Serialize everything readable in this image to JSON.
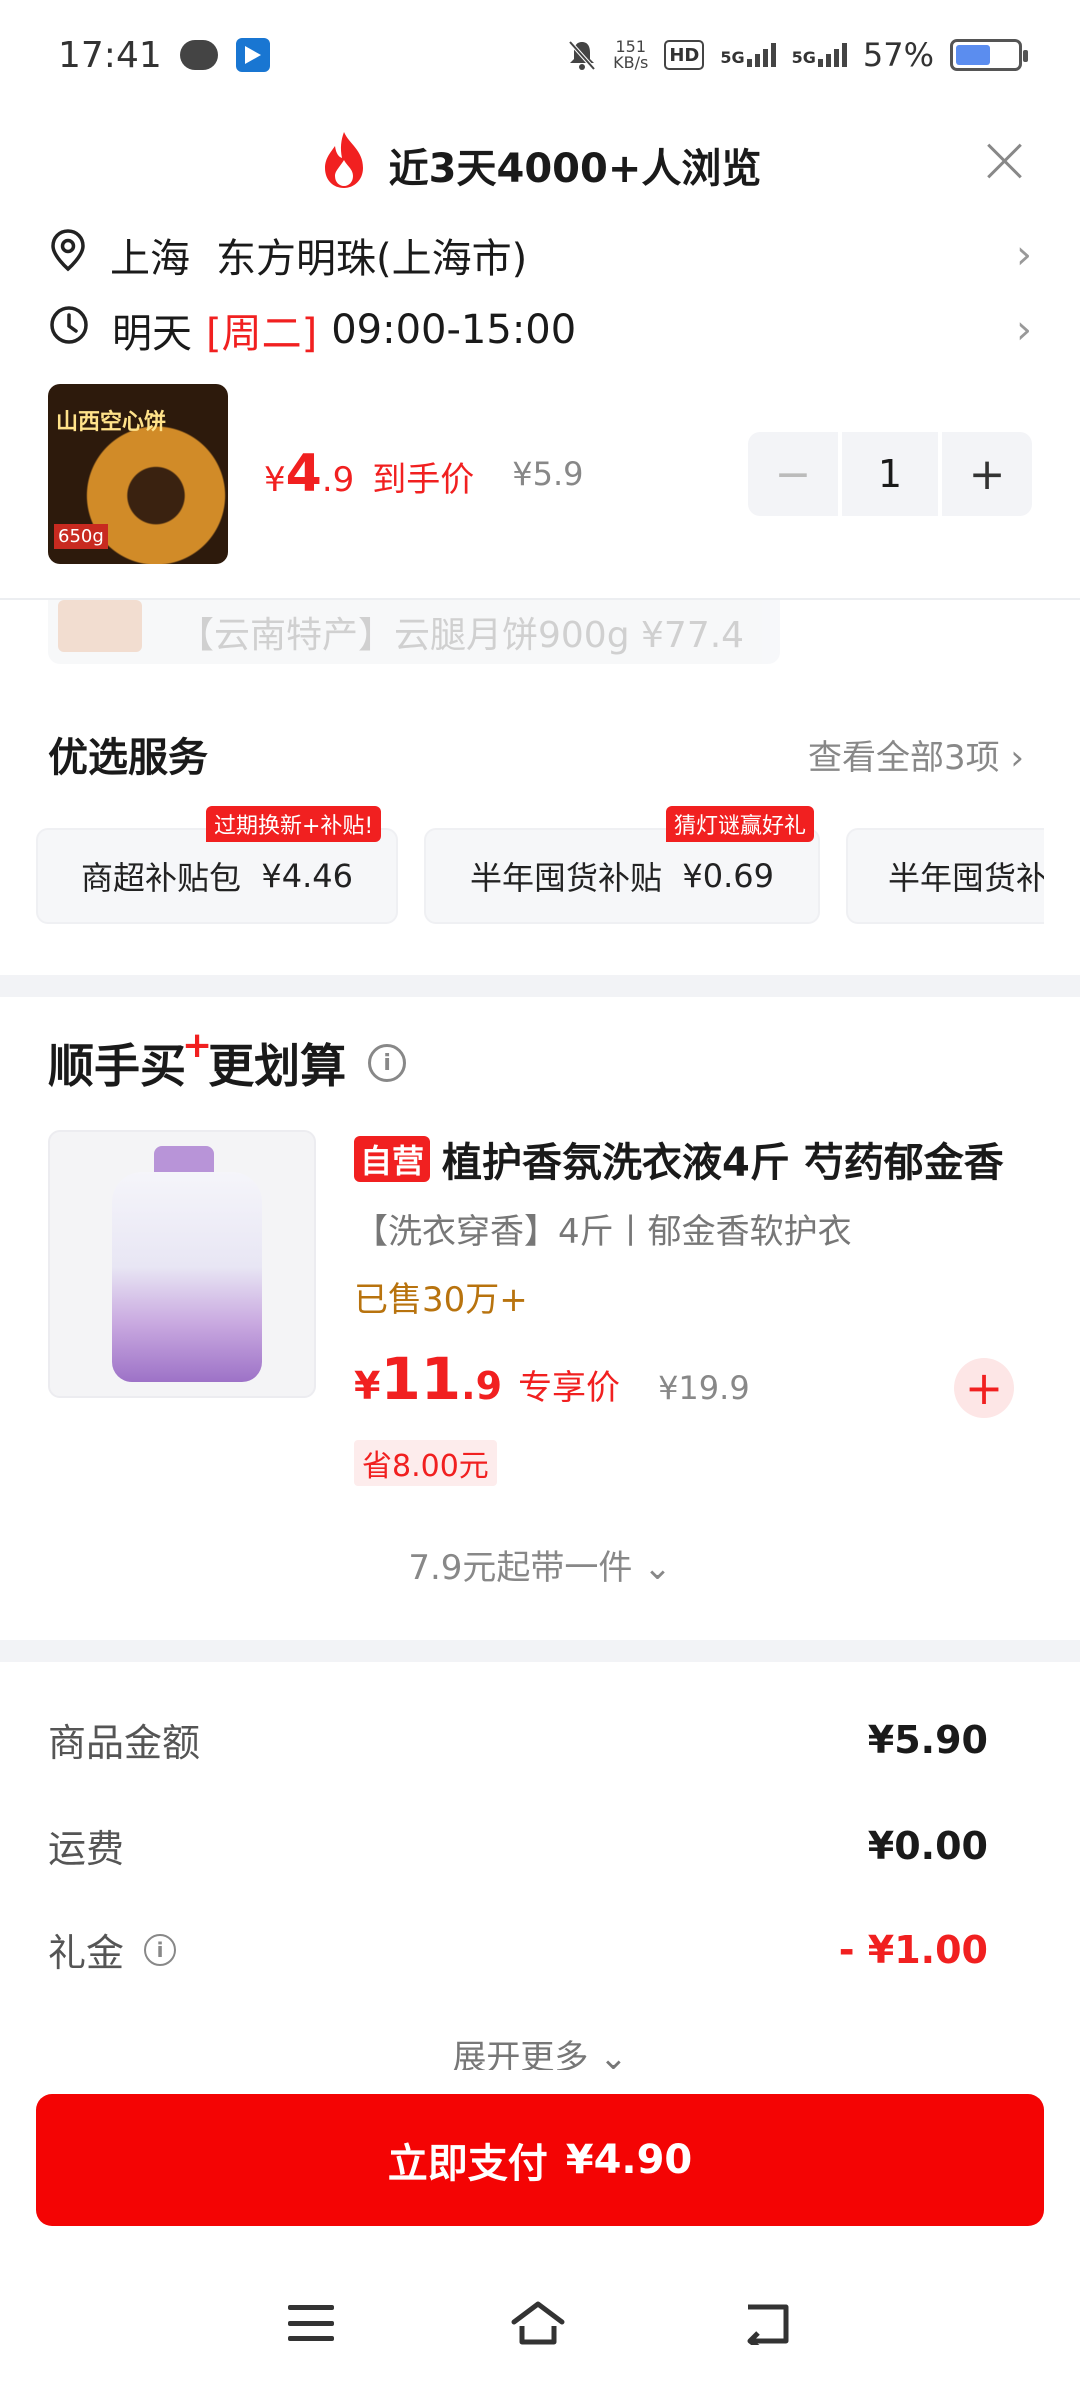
{
  "status_bar": {
    "time": "17:41",
    "net_speed_value": "151",
    "net_speed_unit": "KB/s",
    "hd_label": "HD",
    "signal1": "5G",
    "signal2": "5G",
    "battery": "57%",
    "battery_level": 0.57
  },
  "header": {
    "browse_text": "近3天4000+人浏览",
    "address": {
      "city": "上海",
      "place": "东方明珠(上海市)"
    },
    "delivery": {
      "day": "明天",
      "weekday": "[周二]",
      "hours": "09:00-15:00"
    }
  },
  "product": {
    "thumb_text": "山西空心饼",
    "thumb_weight": "650g",
    "price_currency": "¥",
    "price_int": "4",
    "price_dec": ".9",
    "price_label": "到手价",
    "original_price": "¥5.9",
    "quantity": "1",
    "minus": "−",
    "plus": "+"
  },
  "ghost_item": {
    "text": "【云南特产】云腿月饼900g  ¥77.4"
  },
  "services": {
    "title": "优选服务",
    "more": "查看全部3项 ›",
    "items": [
      {
        "name": "商超补贴包",
        "price": "¥4.46",
        "tag": "过期换新+补贴!"
      },
      {
        "name": "半年囤货补贴",
        "price": "¥0.69",
        "tag": "猜灯谜赢好礼"
      },
      {
        "name": "半年囤货补",
        "price": ""
      }
    ]
  },
  "buy_together": {
    "title_a": "顺手买",
    "title_plus": "+",
    "title_b": "更划算",
    "info": "i",
    "tag": "自营",
    "name": "植护香氛洗衣液4斤 芍药郁金香",
    "subtitle": "【洗衣穿香】4斤丨郁金香软护衣",
    "sold": "已售30万+",
    "price_currency": "¥",
    "price_int": "11",
    "price_dec": ".9",
    "price_label": "专享价",
    "original_price": "¥19.9",
    "save": "省8.00元",
    "add": "+",
    "more": "7.9元起带一件 ⌄"
  },
  "summary": {
    "rows": [
      {
        "label": "商品金额",
        "value": "¥5.90"
      },
      {
        "label": "运费",
        "value": "¥0.00"
      },
      {
        "label": "礼金",
        "value": "- ¥1.00"
      }
    ],
    "expand": "展开更多 ⌄"
  },
  "pay": {
    "label": "立即支付",
    "amount": "¥4.90"
  },
  "colors": {
    "accent": "#f12020",
    "pay_button": "#f40404",
    "sold_text": "#b8730e"
  }
}
